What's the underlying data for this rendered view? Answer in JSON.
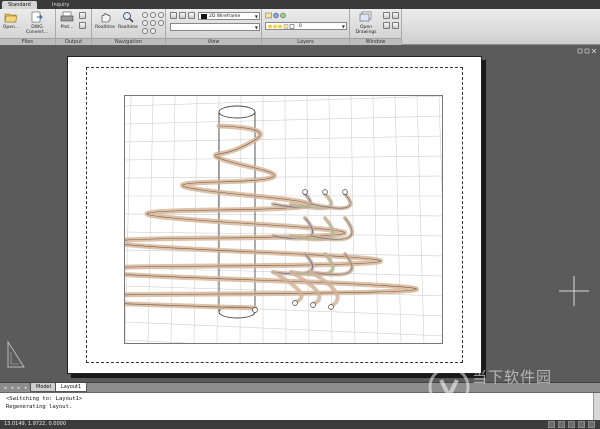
{
  "ribbon": {
    "tabs": [
      {
        "label": "Standard",
        "active": true
      },
      {
        "label": "Inquiry",
        "active": false
      }
    ],
    "files": {
      "title": "Files",
      "open_label": "Open...",
      "dwg_convert_label": "DWG Convert..."
    },
    "output": {
      "title": "Output",
      "plot_label": "Plot..."
    },
    "navigation": {
      "title": "Navigation",
      "realtime_pan_label": "Realtime",
      "realtime_zoom_label": "Realtime"
    },
    "view": {
      "title": "View",
      "visual_style": "2D Wireframe"
    },
    "layers": {
      "title": "Layers",
      "current_layer": "0"
    },
    "window": {
      "title": "Window",
      "open_drawings_label": "Open Drawings"
    }
  },
  "layout_tabs": [
    {
      "label": "Model",
      "active": false
    },
    {
      "label": "Layout1",
      "active": true
    }
  ],
  "command": {
    "line1": "<Switching to: Layout1>",
    "line2": "Regenerating layout."
  },
  "status": {
    "coordinates": "13.0149, 1.9722, 0.0000"
  },
  "watermark": {
    "title": "当下软件园",
    "url": "www.downxia.com"
  },
  "colors": {
    "background": "#5b5b5b",
    "ribbon": "#e2e2e2",
    "coil_copper": "#c9a886",
    "coil_green": "#8fbf8f",
    "coil_blue": "#5a6aa0"
  }
}
